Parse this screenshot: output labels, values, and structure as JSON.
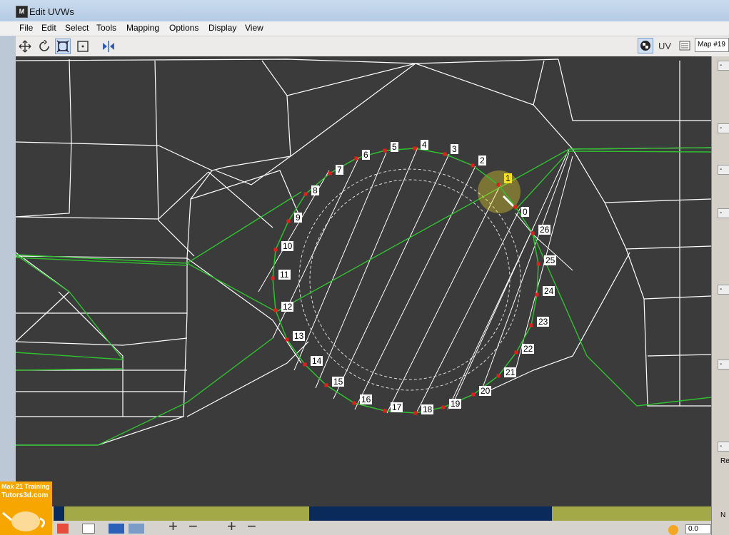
{
  "window": {
    "title": "Edit UVWs",
    "app_icon": "M"
  },
  "menu": [
    "File",
    "Edit",
    "Select",
    "Tools",
    "Mapping",
    "Options",
    "Display",
    "View"
  ],
  "toolbar": {
    "tools": [
      "move-icon",
      "rotate-icon",
      "scale-icon",
      "freeform-icon",
      "mirror-icon"
    ],
    "uv_label": "UV",
    "map_label": "Map #19"
  },
  "viewport": {
    "vertex_labels": [
      "0",
      "1",
      "2",
      "3",
      "4",
      "5",
      "6",
      "7",
      "8",
      "9",
      "10",
      "11",
      "12",
      "13",
      "14",
      "15",
      "16",
      "17",
      "18",
      "19",
      "20",
      "21",
      "22",
      "23",
      "24",
      "25",
      "26"
    ],
    "selected_vertex": "1"
  },
  "bottom": {
    "coord_value": "0.0"
  },
  "watermark": {
    "line1": "Mak 21 Training",
    "line2": "Tutors3d.com"
  },
  "right_panel": {
    "labels": [
      "Re",
      "N"
    ]
  },
  "colors": {
    "viewport_bg": "#3b3b3b",
    "wire": "#ffffff",
    "seam": "#2fbf2f",
    "vertex": "#e0201b",
    "selected": "#f5e028"
  }
}
